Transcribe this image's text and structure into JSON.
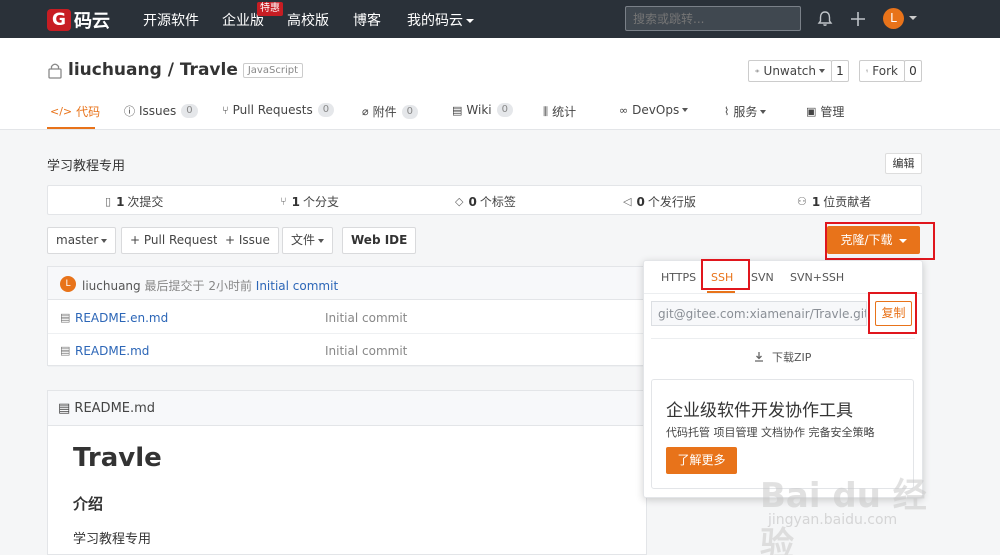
{
  "nav": {
    "logo_letter": "G",
    "logo_text": "码云",
    "items": [
      "开源软件",
      "企业版",
      "高校版",
      "博客",
      "我的码云"
    ],
    "hot_badge": "特惠",
    "search_placeholder": "搜索或跳转...",
    "avatar_letter": "L"
  },
  "repo": {
    "title": "liuchuang / Travle",
    "lang": "JavaScript",
    "unwatch_label": "Unwatch",
    "unwatch_count": "1",
    "fork_label": "Fork",
    "fork_count": "0",
    "tabs": [
      {
        "label": "代码",
        "count": ""
      },
      {
        "label": "Issues",
        "count": "0"
      },
      {
        "label": "Pull Requests",
        "count": "0"
      },
      {
        "label": "附件",
        "count": "0"
      },
      {
        "label": "Wiki",
        "count": "0"
      },
      {
        "label": "统计",
        "count": ""
      },
      {
        "label": "DevOps",
        "count": ""
      },
      {
        "label": "服务",
        "count": ""
      },
      {
        "label": "管理",
        "count": ""
      }
    ]
  },
  "main": {
    "description": "学习教程专用",
    "edit_label": "编辑",
    "stats": [
      {
        "num": "1",
        "label": "次提交"
      },
      {
        "num": "1",
        "label": "个分支"
      },
      {
        "num": "0",
        "label": "个标签"
      },
      {
        "num": "0",
        "label": "个发行版"
      },
      {
        "num": "1",
        "label": "位贡献者"
      }
    ],
    "branch": "master",
    "pr_button": "+ Pull Request",
    "issue_button": "+ Issue",
    "file_button": "文件",
    "webide_button": "Web IDE",
    "clone_button": "克隆/下载",
    "commit": {
      "avatar": "L",
      "user": "liuchuang",
      "meta": "最后提交于 2小时前",
      "message": "Initial commit"
    },
    "files": [
      {
        "name": "README.en.md",
        "msg": "Initial commit"
      },
      {
        "name": "README.md",
        "msg": "Initial commit"
      }
    ],
    "readme": {
      "header": "README.md",
      "h1": "Travle",
      "h2": "介绍",
      "p": "学习教程专用"
    }
  },
  "clone_dropdown": {
    "tabs": [
      "HTTPS",
      "SSH",
      "SVN",
      "SVN+SSH"
    ],
    "active_tab": "SSH",
    "url": "git@gitee.com:xiamenair/Travle.git",
    "copy_label": "复制",
    "download_zip": "下载ZIP",
    "promo_title": "企业级软件开发协作工具",
    "promo_sub": "代码托管 项目管理 文档协作 完备安全策略",
    "promo_button": "了解更多"
  },
  "watermark": {
    "logo": "Bai du 经验",
    "url": "jingyan.baidu.com"
  },
  "colors": {
    "brand": "#c71d23",
    "accent": "#e8731a",
    "nav_bg": "#2a3139",
    "link": "#2c66b7",
    "highlight_box": "#e0161d"
  }
}
